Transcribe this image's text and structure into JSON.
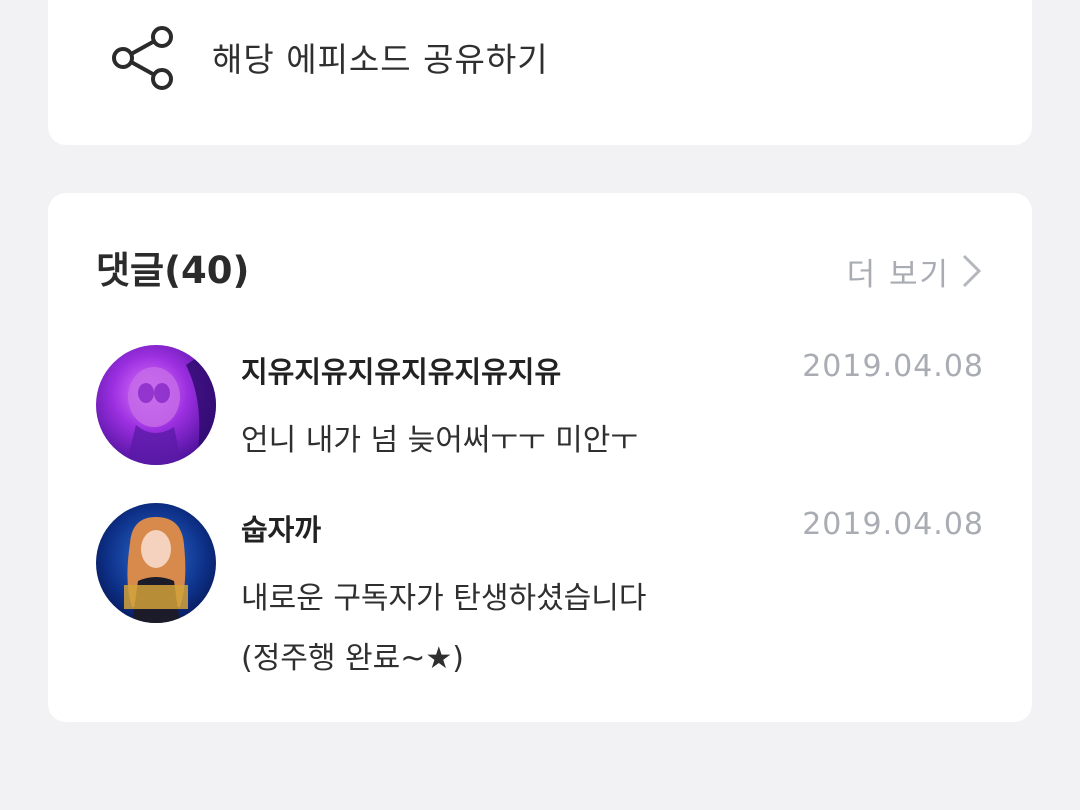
{
  "share": {
    "icon": "share-icon",
    "label": "해당 에피소드 공유하기"
  },
  "comments": {
    "title": "댓글(40)",
    "more_label": "더 보기",
    "more_icon": "chevron-right-icon",
    "items": [
      {
        "author": "지유지유지유지유지유지유",
        "date": "2019.04.08",
        "lines": [
          "언니 내가 넘 늦어써ㅜㅜ 미안ㅜ"
        ],
        "avatar": "avatar-purple-icon"
      },
      {
        "author": "숩자까",
        "date": "2019.04.08",
        "lines": [
          "내로운 구독자가 탄생하셨습니다",
          "(정주행 완료~★)"
        ],
        "avatar": "avatar-portrait-icon"
      }
    ]
  },
  "colors": {
    "background": "#f2f2f4",
    "card": "#ffffff",
    "muted_text": "#a9adb3",
    "primary_text": "#2b2b2b"
  }
}
